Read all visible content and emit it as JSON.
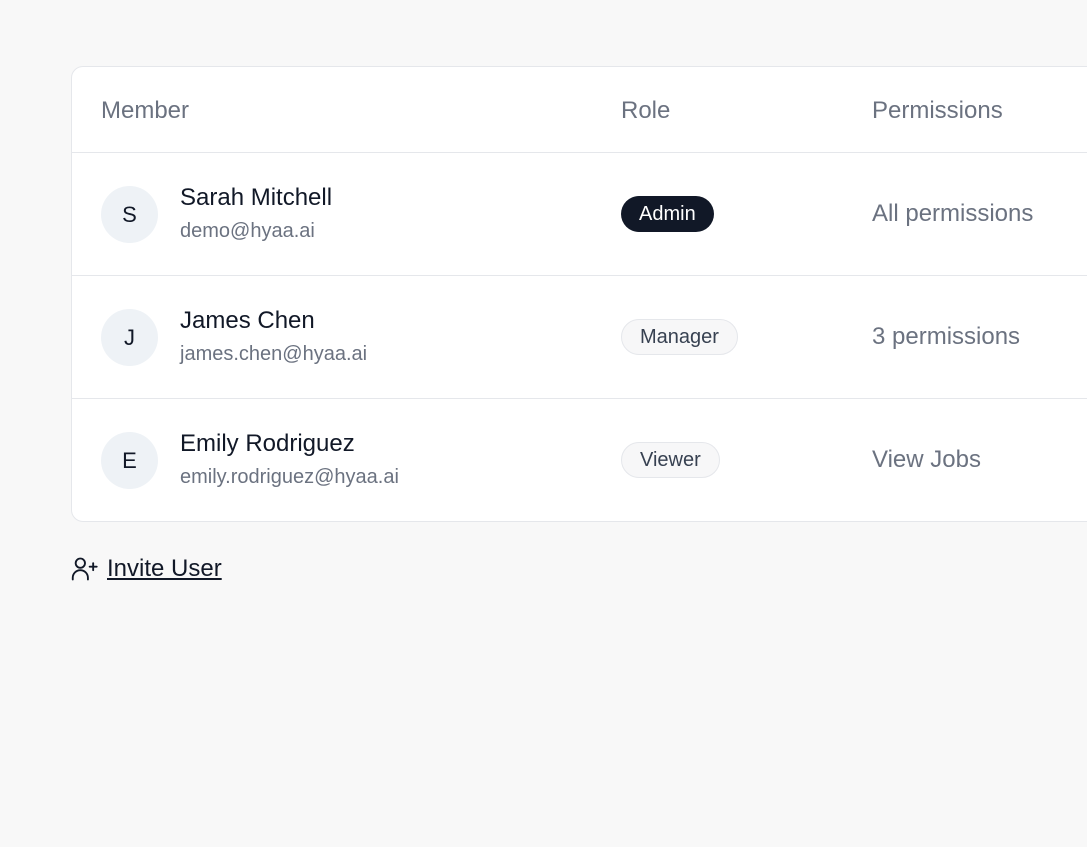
{
  "table": {
    "headers": {
      "member": "Member",
      "role": "Role",
      "permissions": "Permissions"
    },
    "rows": [
      {
        "initial": "S",
        "name": "Sarah Mitchell",
        "email": "demo@hyaa.ai",
        "role": "Admin",
        "permissions": "All permissions"
      },
      {
        "initial": "J",
        "name": "James Chen",
        "email": "james.chen@hyaa.ai",
        "role": "Manager",
        "permissions": "3 permissions"
      },
      {
        "initial": "E",
        "name": "Emily Rodriguez",
        "email": "emily.rodriguez@hyaa.ai",
        "role": "Viewer",
        "permissions": "View Jobs"
      }
    ]
  },
  "actions": {
    "invite_label": "Invite User",
    "invite_icon": "user-plus-icon"
  },
  "colors": {
    "admin_badge_bg": "#111827",
    "badge_light_bg": "#f7f7f8",
    "muted_text": "#6b7280"
  }
}
